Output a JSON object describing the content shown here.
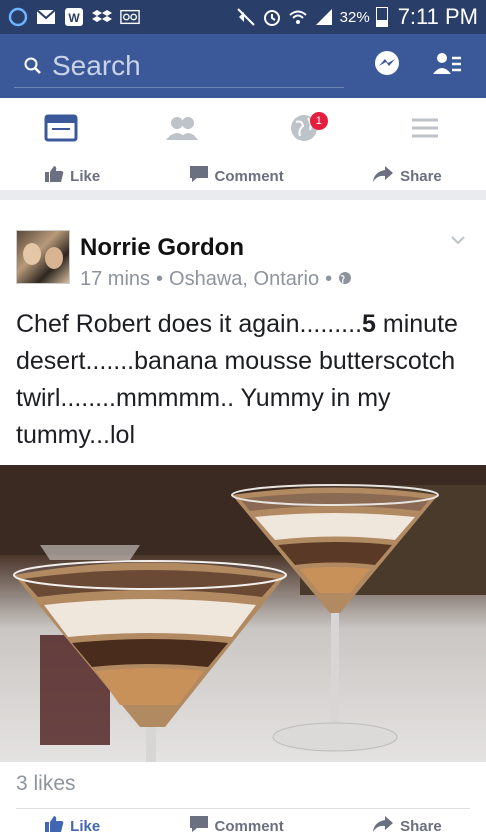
{
  "status_bar": {
    "battery": "32%",
    "time": "7:11 PM"
  },
  "search": {
    "placeholder": "Search"
  },
  "nav": {
    "notification_count": "1"
  },
  "top_actions": {
    "like": "Like",
    "comment": "Comment",
    "share": "Share"
  },
  "post": {
    "author": "Norrie Gordon",
    "time": "17 mins",
    "location": "Oshawa, Ontario",
    "text_parts": [
      "Chef Robert does it again.........",
      "5",
      " minute desert.......banana mousse butterscotch twirl........mmmmm.. Yummy in my tummy...lol"
    ],
    "likes": "3 likes"
  },
  "bottom_actions": {
    "like": "Like",
    "comment": "Comment",
    "share": "Share"
  },
  "colors": {
    "brand": "#3b5998",
    "status_bar": "#2a3e6a",
    "like_blue": "#4267b2",
    "badge_red": "#e41e3f"
  }
}
